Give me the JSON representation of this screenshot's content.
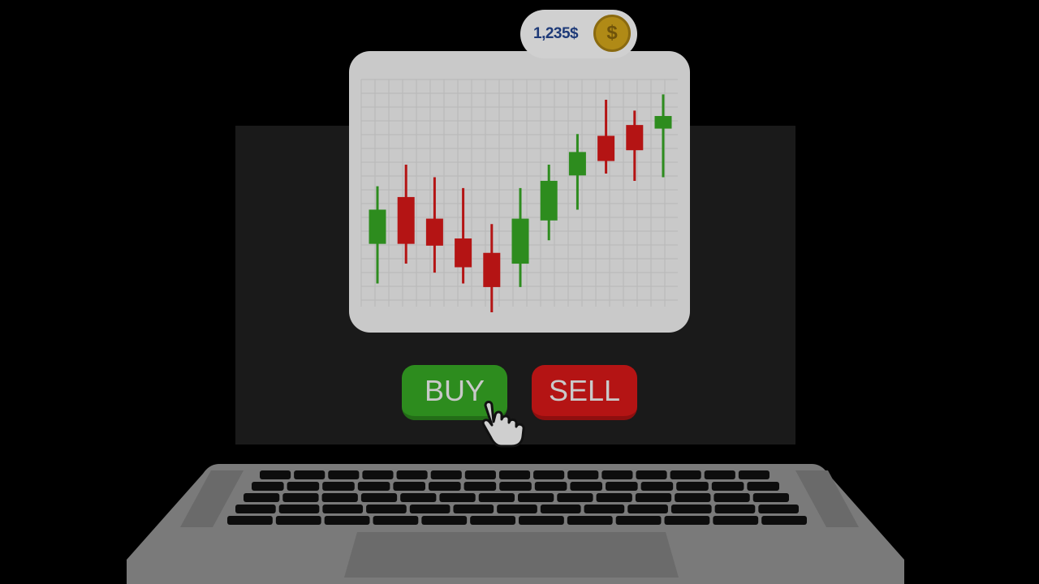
{
  "balance": {
    "amount_label": "1,235$",
    "coin_symbol": "$",
    "coin_icon": "dollar-coin-icon"
  },
  "chart": {
    "type": "candlestick",
    "up_color": "#2d8c1e",
    "down_color": "#b41414",
    "grid": true,
    "candles": [
      {
        "dir": "up",
        "high": 0.7,
        "low": 0.16,
        "open": 0.38,
        "close": 0.57
      },
      {
        "dir": "down",
        "high": 0.82,
        "low": 0.27,
        "open": 0.64,
        "close": 0.38
      },
      {
        "dir": "down",
        "high": 0.75,
        "low": 0.22,
        "open": 0.52,
        "close": 0.37
      },
      {
        "dir": "down",
        "high": 0.69,
        "low": 0.16,
        "open": 0.41,
        "close": 0.25
      },
      {
        "dir": "down",
        "high": 0.49,
        "low": 0.0,
        "open": 0.33,
        "close": 0.14
      },
      {
        "dir": "up",
        "high": 0.69,
        "low": 0.14,
        "open": 0.27,
        "close": 0.52
      },
      {
        "dir": "up",
        "high": 0.82,
        "low": 0.4,
        "open": 0.51,
        "close": 0.73
      },
      {
        "dir": "up",
        "high": 0.99,
        "low": 0.57,
        "open": 0.76,
        "close": 0.89
      },
      {
        "dir": "down",
        "high": 1.18,
        "low": 0.77,
        "open": 0.98,
        "close": 0.84
      },
      {
        "dir": "down",
        "high": 1.12,
        "low": 0.73,
        "open": 1.04,
        "close": 0.9
      },
      {
        "dir": "up",
        "high": 1.21,
        "low": 0.75,
        "open": 1.02,
        "close": 1.09
      }
    ]
  },
  "buttons": {
    "buy_label": "BUY",
    "sell_label": "SELL",
    "buy_color": "#2d8c1e",
    "sell_color": "#b41414"
  },
  "cursor": {
    "icon": "hand-pointer-icon"
  }
}
